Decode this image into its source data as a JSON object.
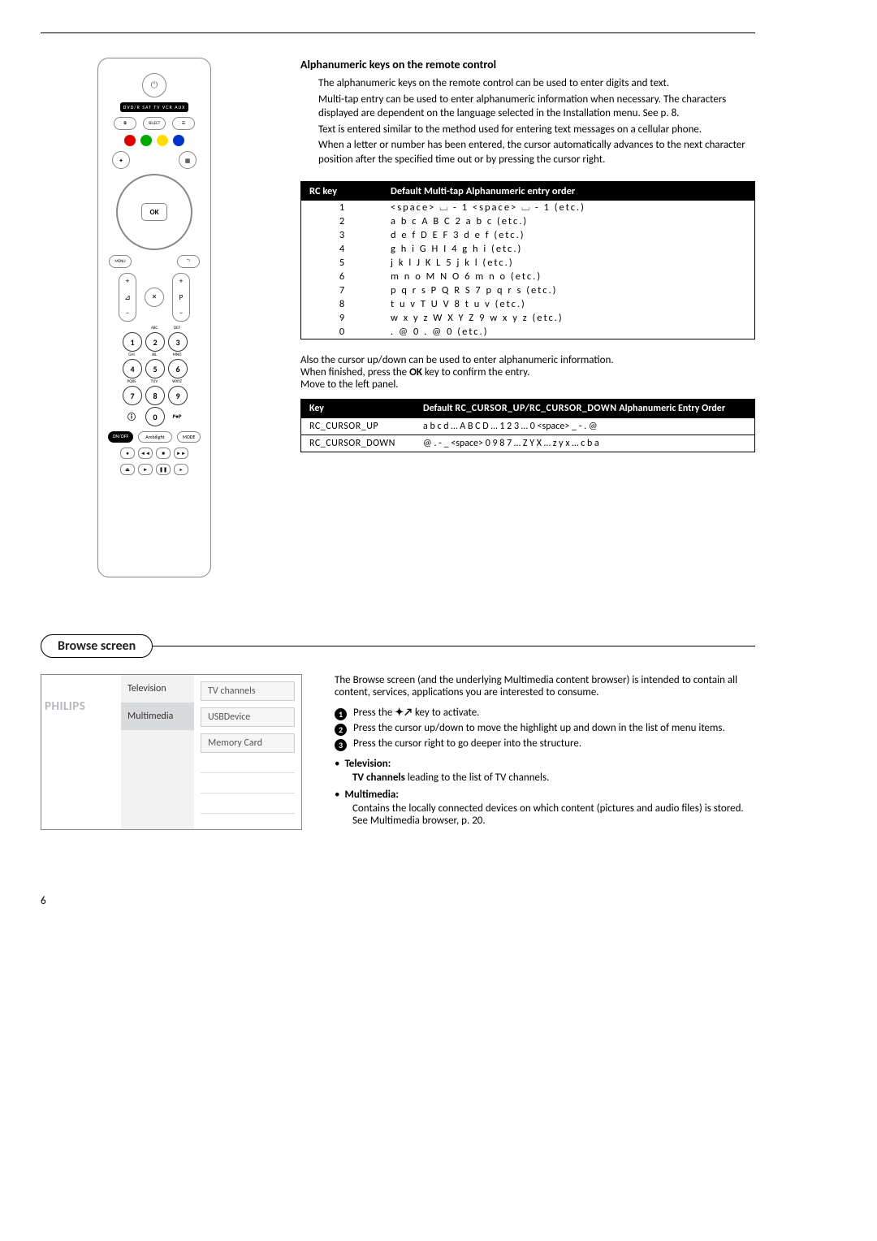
{
  "page_number": "6",
  "alpha": {
    "title": "Alphanumeric keys on the remote control",
    "p1": "The alphanumeric keys on the remote control can be used to enter digits and text.",
    "p2": "Multi-tap entry can be used to enter alphanumeric information when necessary. The characters displayed are dependent on the language selected in the Installation menu. See p. 8.",
    "p3": "Text is entered similar to the method used for entering text messages on a cellular phone.",
    "p4": "When a letter or number has been entered, the cursor automatically advances to the next character position after the specified time out or by pressing the cursor right."
  },
  "rc_table": {
    "head_key": "RC key",
    "head_order": "Default Multi-tap Alphanumeric entry order",
    "rows": [
      {
        "k": "1",
        "v": "<space>  ⌴  -  1  <space>  ⌴  -  1  (etc.)"
      },
      {
        "k": "2",
        "v": "a   b   c   A   B   C   2   a   b   c    (etc.)"
      },
      {
        "k": "3",
        "v": "d   e   f   D   E   F   3   d   e   f    (etc.)"
      },
      {
        "k": "4",
        "v": "g   h   i   G   H   I   4   g   h   i    (etc.)"
      },
      {
        "k": "5",
        "v": "j   k   l   J   K   L   5   j   k   l    (etc.)"
      },
      {
        "k": "6",
        "v": "m   n   o   M   N   O   6   m   n   o    (etc.)"
      },
      {
        "k": "7",
        "v": "p   q   r   s   P   Q   R   S   7   p   q   r   s    (etc.)"
      },
      {
        "k": "8",
        "v": "t   u   v   T   U   V   8   t   u   v    (etc.)"
      },
      {
        "k": "9",
        "v": "w   x   y   z   W  X   Y   Z   9   w   x   y   z    (etc.)"
      },
      {
        "k": "0",
        "v": ".   @    0   .   @    0   (etc.)"
      }
    ]
  },
  "mid": {
    "p1": "Also the cursor up/down can be used to enter alphanumeric information.",
    "p2_a": "When finished, press the ",
    "p2_ok": "OK",
    "p2_b": " key to confirm the entry.",
    "p3": "Move to the left panel."
  },
  "cursor_table": {
    "head_key": "Key",
    "head_order_a": "Default ",
    "head_order_sc": "RC_CURSOR_UP/RC_CURSOR_DOWN",
    "head_order_b": " Alphanumeric Entry Order",
    "rows": [
      {
        "k": "RC_CURSOR_UP",
        "v": "a  b  c  d  … A B C D … 1 2 3 … 0  <space>  _  -  . @"
      },
      {
        "k": "RC_CURSOR_DOWN",
        "v": "@  .  -  _  <space>  0 9 8 7 … Z Y X … z y x … c  b  a"
      }
    ]
  },
  "browse": {
    "heading": "Browse screen",
    "intro": "The Browse screen (and the underlying Multimedia content browser) is intended to contain all content, services, applications you are interested to consume.",
    "step1_a": "Press the ",
    "step1_b": " key to activate.",
    "step2": "Press the cursor up/down to move the highlight up and down in the list of menu items.",
    "step3": "Press the cursor right to go deeper into the structure.",
    "tv_label": "Television:",
    "tv_body_a": "TV channels",
    "tv_body_b": " leading to the list of TV channels.",
    "mm_label": "Multimedia:",
    "mm_body": "Contains the locally connected devices on which content (pictures and audio files) is stored. See Multimedia browser, p. 20."
  },
  "browse_ui": {
    "brand": "PHILIPS",
    "left1": "Television",
    "left2": "Multimedia",
    "right1": "TV channels",
    "right2": "USBDevice",
    "right3": "Memory Card"
  },
  "remote": {
    "modebar": "DVD/R  SAT  TV  VCR  AUX",
    "select": "SELECT",
    "ok": "OK",
    "menu": "MENU",
    "ambilight": "Ambilight",
    "mode": "MODE",
    "onoff": "ON/OFF",
    "abc": "ABC",
    "def": "DEF",
    "ghi": "GHI",
    "jkl": "JKL",
    "mno": "MNO",
    "pqrs": "PQRS",
    "tuv": "TUV",
    "wxyz": "WXYZ"
  }
}
